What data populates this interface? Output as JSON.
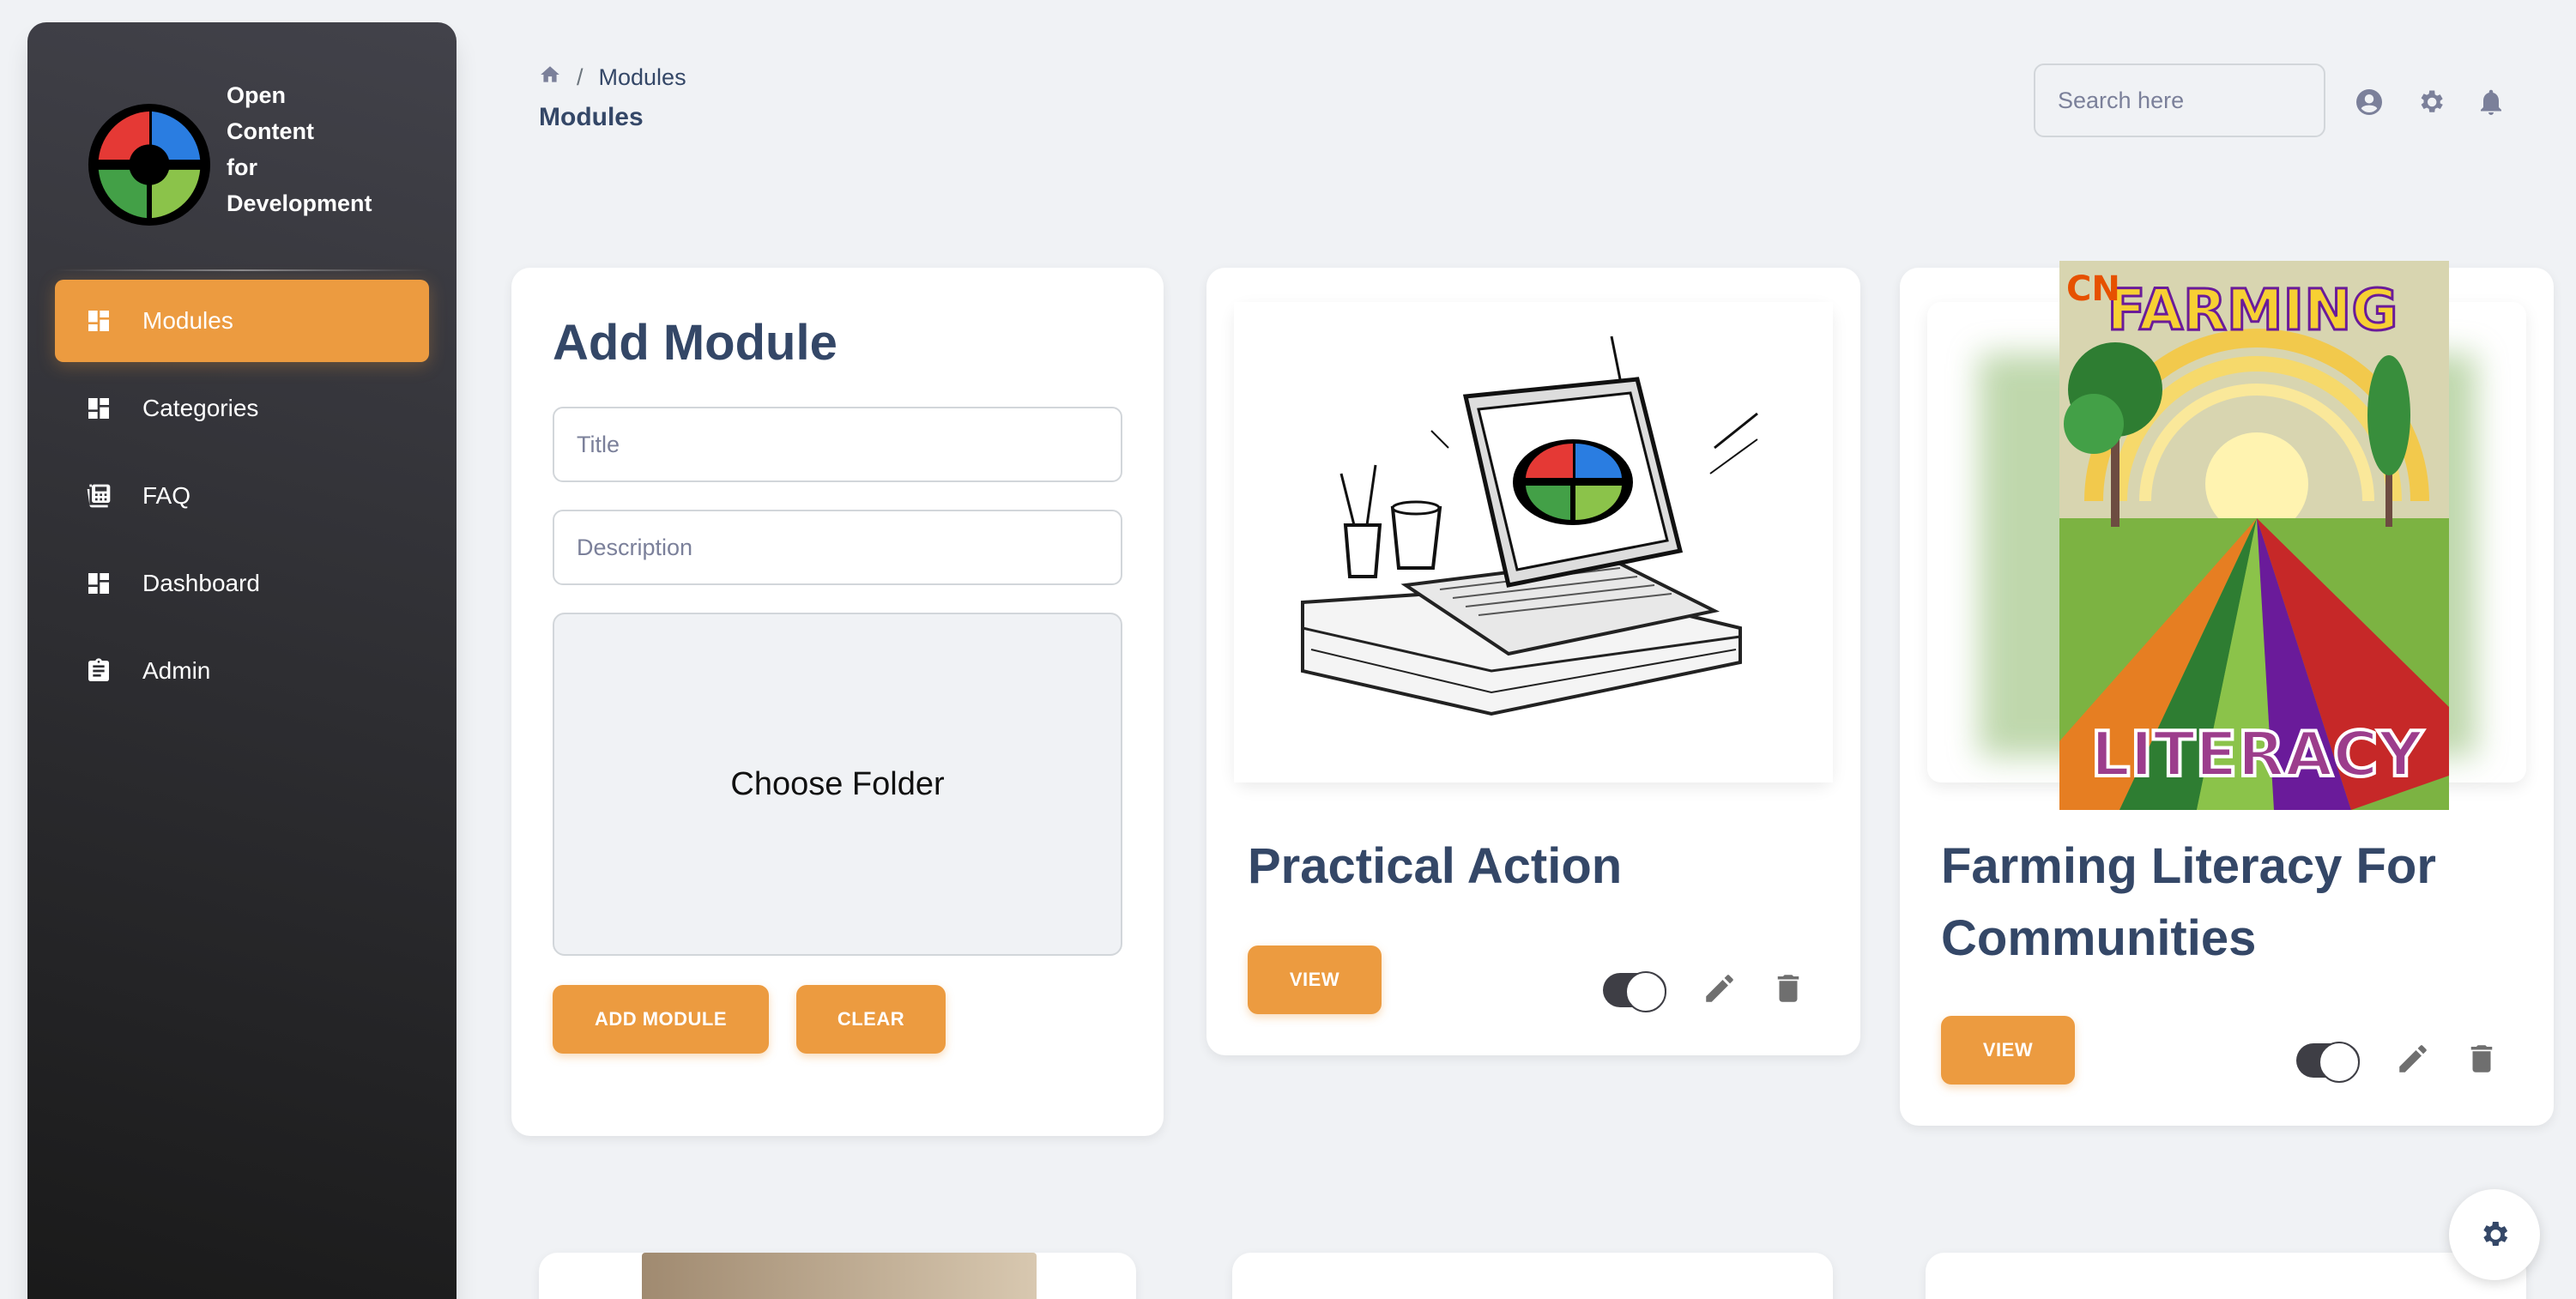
{
  "brand": {
    "line1": "Open",
    "line2": "Content",
    "line3": "for",
    "line4": "Development"
  },
  "sidebar": {
    "items": [
      {
        "label": "Modules",
        "icon": "dashboard-icon",
        "active": true
      },
      {
        "label": "Categories",
        "icon": "dashboard-icon",
        "active": false
      },
      {
        "label": "FAQ",
        "icon": "calculator-icon",
        "active": false
      },
      {
        "label": "Dashboard",
        "icon": "dashboard-icon",
        "active": false
      },
      {
        "label": "Admin",
        "icon": "clipboard-icon",
        "active": false
      }
    ]
  },
  "header": {
    "breadcrumb_current": "Modules",
    "breadcrumb_separator": "/",
    "title": "Modules",
    "search_placeholder": "Search here"
  },
  "add_module": {
    "title": "Add Module",
    "title_placeholder": "Title",
    "description_placeholder": "Description",
    "folder_label": "Choose Folder",
    "add_button": "ADD MODULE",
    "clear_button": "CLEAR"
  },
  "modules": [
    {
      "title": "Practical Action",
      "view_label": "VIEW",
      "enabled": true
    },
    {
      "title_line1": "Farming Literacy For",
      "title_line2": "Communities",
      "view_label": "VIEW",
      "enabled": true,
      "poster_top": "FARMING",
      "poster_bottom": "LITERACY",
      "poster_logo": "CN"
    }
  ],
  "colors": {
    "accent": "#ec9b40",
    "text": "#344767",
    "muted": "#7b809a",
    "sidebar_dark": "#191919"
  }
}
